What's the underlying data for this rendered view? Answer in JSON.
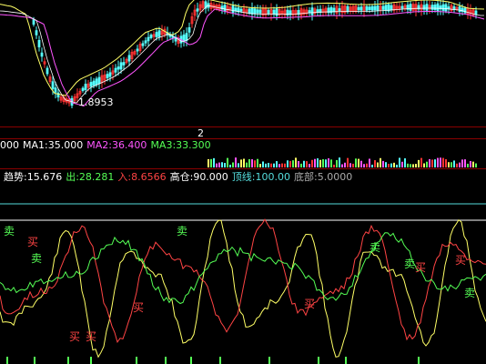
{
  "price_panel": {
    "low_label": "1.8953"
  },
  "divider_number": "2",
  "volume_panel": {
    "indicators": [
      {
        "label": "000",
        "color": "#ffffff"
      },
      {
        "label": "MA1:35.000",
        "color": "#ffffff"
      },
      {
        "label": "MA2:36.400",
        "color": "#ff55ff"
      },
      {
        "label": "MA3:33.300",
        "color": "#55ff55"
      }
    ]
  },
  "osc_panel": {
    "indicators": [
      {
        "label": "趋势:15.676",
        "color": "#ffffff"
      },
      {
        "label": "出:28.281",
        "color": "#55ff55"
      },
      {
        "label": "入:8.6566",
        "color": "#ff4444"
      },
      {
        "label": "高仓:90.000",
        "color": "#ffffff"
      },
      {
        "label": "顶线:100.00",
        "color": "#55dddd"
      },
      {
        "label": "底部:5.0000",
        "color": "#aaaaaa"
      }
    ],
    "sell_marks": [
      "卖",
      "卖",
      "卖",
      "卖",
      "卖",
      "卖"
    ],
    "buy_marks": [
      "买",
      "买",
      "买",
      "买",
      "买",
      "买",
      "买"
    ]
  },
  "colors": {
    "up_candle": "#ff3333",
    "down_candle": "#55ffff",
    "ma_yellow": "#ffff66",
    "ma_magenta": "#ff55ff",
    "grid_red": "#8b0000"
  }
}
